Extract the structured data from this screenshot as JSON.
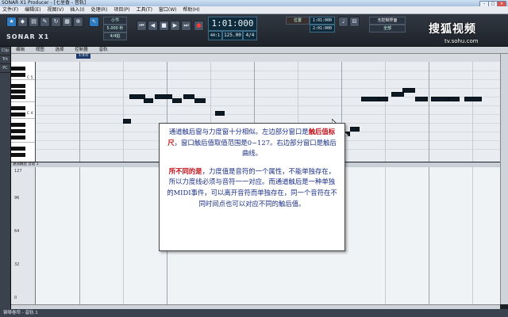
{
  "window": {
    "title": "SONAR X1 Producer - [七里香 - 音轨]"
  },
  "menu": [
    "文件(F)",
    "编辑(E)",
    "视图(V)",
    "插入(I)",
    "处理(R)",
    "项目(P)",
    "工具(T)",
    "窗口(W)",
    "帮助(H)"
  ],
  "control": {
    "logo": "SONAR X1",
    "time": "1:01:000",
    "tempo": "125.00",
    "meter": "4/4",
    "bars_beats": "44:1",
    "small_left": "5.000 秒",
    "small_left2": "4/4拍",
    "loop_start": "1:01:000",
    "loop_end": "2:01:000",
    "pos_label": "位置",
    "mode_label": "无控制界面",
    "tab1": "小节",
    "tab2": "全部"
  },
  "left_tabs": [
    "Clip",
    "Trk",
    "PC"
  ],
  "pianoroll": {
    "menu": [
      "编辑",
      "视图",
      "选择",
      "控制器",
      "音轨"
    ],
    "ruler_marker": "1:0:0",
    "c5_label": "C 5",
    "c4_label": "C 4",
    "ctrl_label": "通道触后 音轨 1",
    "ctrl_scale": [
      "127",
      "96",
      "64",
      "32",
      "0"
    ]
  },
  "callout": {
    "p1a": "通道触后窗与力度窗十分相似。左边部分窗口是",
    "p1red": "触后值标尺",
    "p1b": "，窗口触后值取值范围是0~127。右边部分窗口是触后曲线。",
    "p2red": "所不同的是",
    "p2b": "，力度值是音符的一个属性，不能单独存在，所以力度线必须与音符一一对应。而通道触后是一种单独的MIDI事件，可以离开音符而单独存在，同一个音符在不同时间点也可以对应不同的触后值。"
  },
  "watermark": {
    "main": "搜狐视频",
    "sub": "tv.sohu.com"
  },
  "status": {
    "left": "钢琴卷帘 - 音轨 1"
  },
  "colors": {
    "accent": "#c0101a",
    "callout_text": "#1a2f86"
  }
}
